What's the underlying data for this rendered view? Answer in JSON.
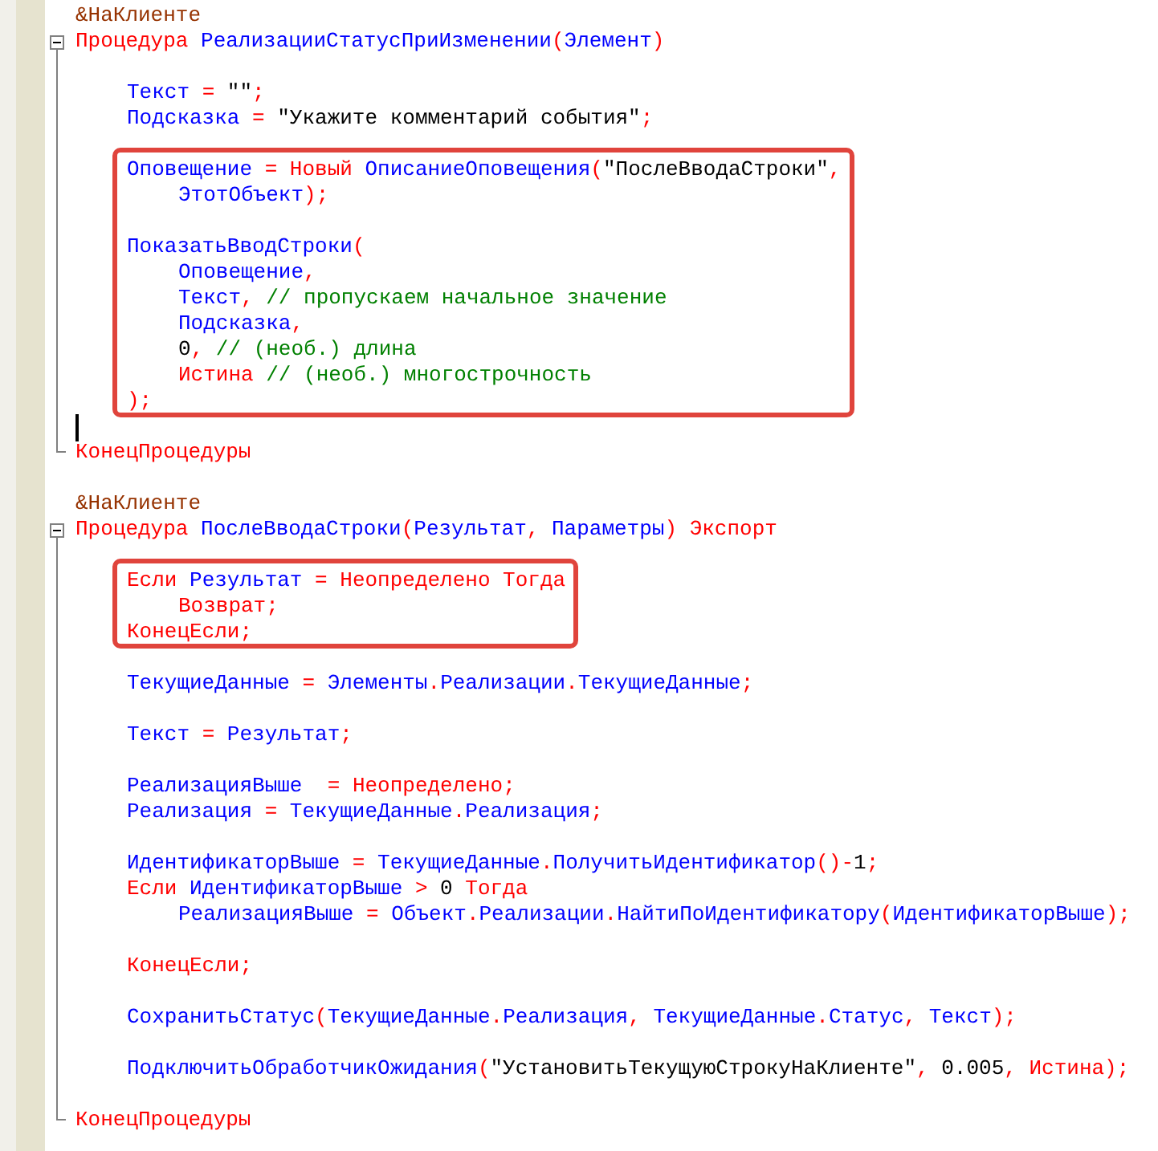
{
  "editor": {
    "blocks": [
      {
        "kind": "directive",
        "text": "&НаКлиенте"
      },
      {
        "kind": "procedure",
        "header": [
          {
            "kind": "keyword",
            "text": "Процедура "
          },
          {
            "kind": "name",
            "text": "РеализацииСтатусПриИзменении"
          },
          {
            "kind": "operator",
            "text": "("
          },
          {
            "kind": "name",
            "text": "Элемент"
          },
          {
            "kind": "operator",
            "text": ")"
          }
        ],
        "body": [
          {
            "kind": "blank"
          },
          {
            "kind": "line",
            "tokens": [
              {
                "kind": "name",
                "text": "Текст"
              },
              {
                "kind": "operator",
                "text": " = "
              },
              {
                "kind": "string",
                "text": "\"\""
              },
              {
                "kind": "operator",
                "text": ";"
              }
            ]
          },
          {
            "kind": "line",
            "tokens": [
              {
                "kind": "name",
                "text": "Подсказка"
              },
              {
                "kind": "operator",
                "text": " = "
              },
              {
                "kind": "string",
                "text": "\"Укажите комментарий события\""
              },
              {
                "kind": "operator",
                "text": ";"
              }
            ]
          },
          {
            "kind": "blank"
          },
          {
            "kind": "highlight",
            "children": [
              {
                "kind": "line",
                "tokens": [
                  {
                    "kind": "name",
                    "text": "Оповещение"
                  },
                  {
                    "kind": "operator",
                    "text": " = "
                  },
                  {
                    "kind": "keyword",
                    "text": "Новый "
                  },
                  {
                    "kind": "name",
                    "text": "ОписаниеОповещения"
                  },
                  {
                    "kind": "operator",
                    "text": "("
                  },
                  {
                    "kind": "string",
                    "text": "\"ПослеВводаСтроки\""
                  },
                  {
                    "kind": "operator",
                    "text": ","
                  }
                ],
                "children": [
                  {
                    "kind": "line",
                    "tokens": [
                      {
                        "kind": "name",
                        "text": "ЭтотОбъект"
                      },
                      {
                        "kind": "operator",
                        "text": ");"
                      }
                    ]
                  }
                ]
              },
              {
                "kind": "blank"
              },
              {
                "kind": "line",
                "tokens": [
                  {
                    "kind": "name",
                    "text": "ПоказатьВводСтроки"
                  },
                  {
                    "kind": "operator",
                    "text": "("
                  }
                ],
                "children": [
                  {
                    "kind": "line",
                    "tokens": [
                      {
                        "kind": "name",
                        "text": "Оповещение"
                      },
                      {
                        "kind": "operator",
                        "text": ","
                      }
                    ]
                  },
                  {
                    "kind": "line",
                    "tokens": [
                      {
                        "kind": "name",
                        "text": "Текст"
                      },
                      {
                        "kind": "operator",
                        "text": ", "
                      },
                      {
                        "kind": "comment",
                        "text": "// пропускаем начальное значение"
                      }
                    ]
                  },
                  {
                    "kind": "line",
                    "tokens": [
                      {
                        "kind": "name",
                        "text": "Подсказка"
                      },
                      {
                        "kind": "operator",
                        "text": ","
                      }
                    ]
                  },
                  {
                    "kind": "line",
                    "tokens": [
                      {
                        "kind": "number",
                        "text": "0"
                      },
                      {
                        "kind": "operator",
                        "text": ", "
                      },
                      {
                        "kind": "comment",
                        "text": "// (необ.) длина"
                      }
                    ]
                  },
                  {
                    "kind": "line",
                    "tokens": [
                      {
                        "kind": "keyword",
                        "text": "Истина "
                      },
                      {
                        "kind": "comment",
                        "text": "// (необ.) многострочность"
                      }
                    ]
                  }
                ]
              },
              {
                "kind": "line",
                "tokens": [
                  {
                    "kind": "operator",
                    "text": ");"
                  }
                ]
              }
            ]
          },
          {
            "kind": "blank",
            "cursor": true
          }
        ],
        "footer": [
          {
            "kind": "keyword",
            "text": "КонецПроцедуры"
          }
        ]
      },
      {
        "kind": "blank"
      },
      {
        "kind": "directive",
        "text": "&НаКлиенте"
      },
      {
        "kind": "procedure",
        "header": [
          {
            "kind": "keyword",
            "text": "Процедура "
          },
          {
            "kind": "name",
            "text": "ПослеВводаСтроки"
          },
          {
            "kind": "operator",
            "text": "("
          },
          {
            "kind": "name",
            "text": "Результат"
          },
          {
            "kind": "operator",
            "text": ", "
          },
          {
            "kind": "name",
            "text": "Параметры"
          },
          {
            "kind": "operator",
            "text": ") "
          },
          {
            "kind": "keyword",
            "text": "Экспорт"
          }
        ],
        "body": [
          {
            "kind": "blank"
          },
          {
            "kind": "highlight",
            "children": [
              {
                "kind": "line",
                "tokens": [
                  {
                    "kind": "keyword",
                    "text": "Если "
                  },
                  {
                    "kind": "name",
                    "text": "Результат"
                  },
                  {
                    "kind": "operator",
                    "text": " = "
                  },
                  {
                    "kind": "keyword",
                    "text": "Неопределено Тогда"
                  }
                ],
                "children": [
                  {
                    "kind": "line",
                    "tokens": [
                      {
                        "kind": "keyword",
                        "text": "Возврат;"
                      }
                    ]
                  }
                ]
              },
              {
                "kind": "line",
                "tokens": [
                  {
                    "kind": "keyword",
                    "text": "КонецЕсли;"
                  }
                ]
              }
            ]
          },
          {
            "kind": "blank"
          },
          {
            "kind": "line",
            "tokens": [
              {
                "kind": "name",
                "text": "ТекущиеДанные"
              },
              {
                "kind": "operator",
                "text": " = "
              },
              {
                "kind": "name",
                "text": "Элементы"
              },
              {
                "kind": "operator",
                "text": "."
              },
              {
                "kind": "name",
                "text": "Реализации"
              },
              {
                "kind": "operator",
                "text": "."
              },
              {
                "kind": "name",
                "text": "ТекущиеДанные"
              },
              {
                "kind": "operator",
                "text": ";"
              }
            ]
          },
          {
            "kind": "blank"
          },
          {
            "kind": "line",
            "tokens": [
              {
                "kind": "name",
                "text": "Текст"
              },
              {
                "kind": "operator",
                "text": " = "
              },
              {
                "kind": "name",
                "text": "Результат"
              },
              {
                "kind": "operator",
                "text": ";"
              }
            ]
          },
          {
            "kind": "blank"
          },
          {
            "kind": "line",
            "tokens": [
              {
                "kind": "name",
                "text": "РеализацияВыше"
              },
              {
                "kind": "operator",
                "text": "  = "
              },
              {
                "kind": "keyword",
                "text": "Неопределено"
              },
              {
                "kind": "operator",
                "text": ";"
              }
            ]
          },
          {
            "kind": "line",
            "tokens": [
              {
                "kind": "name",
                "text": "Реализация"
              },
              {
                "kind": "operator",
                "text": " = "
              },
              {
                "kind": "name",
                "text": "ТекущиеДанные"
              },
              {
                "kind": "operator",
                "text": "."
              },
              {
                "kind": "name",
                "text": "Реализация"
              },
              {
                "kind": "operator",
                "text": ";"
              }
            ]
          },
          {
            "kind": "blank"
          },
          {
            "kind": "line",
            "tokens": [
              {
                "kind": "name",
                "text": "ИдентификаторВыше"
              },
              {
                "kind": "operator",
                "text": " = "
              },
              {
                "kind": "name",
                "text": "ТекущиеДанные"
              },
              {
                "kind": "operator",
                "text": "."
              },
              {
                "kind": "name",
                "text": "ПолучитьИдентификатор"
              },
              {
                "kind": "operator",
                "text": "()-"
              },
              {
                "kind": "number",
                "text": "1"
              },
              {
                "kind": "operator",
                "text": ";"
              }
            ]
          },
          {
            "kind": "line",
            "tokens": [
              {
                "kind": "keyword",
                "text": "Если "
              },
              {
                "kind": "name",
                "text": "ИдентификаторВыше"
              },
              {
                "kind": "operator",
                "text": " > "
              },
              {
                "kind": "number",
                "text": "0 "
              },
              {
                "kind": "keyword",
                "text": "Тогда"
              }
            ],
            "children": [
              {
                "kind": "line",
                "tokens": [
                  {
                    "kind": "name",
                    "text": "РеализацияВыше"
                  },
                  {
                    "kind": "operator",
                    "text": " = "
                  },
                  {
                    "kind": "name",
                    "text": "Объект"
                  },
                  {
                    "kind": "operator",
                    "text": "."
                  },
                  {
                    "kind": "name",
                    "text": "Реализации"
                  },
                  {
                    "kind": "operator",
                    "text": "."
                  },
                  {
                    "kind": "name",
                    "text": "НайтиПоИдентификатору"
                  },
                  {
                    "kind": "operator",
                    "text": "("
                  },
                  {
                    "kind": "name",
                    "text": "ИдентификаторВыше"
                  },
                  {
                    "kind": "operator",
                    "text": ");"
                  }
                ]
              }
            ]
          },
          {
            "kind": "blank"
          },
          {
            "kind": "line",
            "tokens": [
              {
                "kind": "keyword",
                "text": "КонецЕсли;"
              }
            ]
          },
          {
            "kind": "blank"
          },
          {
            "kind": "line",
            "tokens": [
              {
                "kind": "name",
                "text": "СохранитьСтатус"
              },
              {
                "kind": "operator",
                "text": "("
              },
              {
                "kind": "name",
                "text": "ТекущиеДанные"
              },
              {
                "kind": "operator",
                "text": "."
              },
              {
                "kind": "name",
                "text": "Реализация"
              },
              {
                "kind": "operator",
                "text": ", "
              },
              {
                "kind": "name",
                "text": "ТекущиеДанные"
              },
              {
                "kind": "operator",
                "text": "."
              },
              {
                "kind": "name",
                "text": "Статус"
              },
              {
                "kind": "operator",
                "text": ", "
              },
              {
                "kind": "name",
                "text": "Текст"
              },
              {
                "kind": "operator",
                "text": ");"
              }
            ]
          },
          {
            "kind": "blank"
          },
          {
            "kind": "line",
            "tokens": [
              {
                "kind": "name",
                "text": "ПодключитьОбработчикОжидания"
              },
              {
                "kind": "operator",
                "text": "("
              },
              {
                "kind": "string",
                "text": "\"УстановитьТекущуюСтрокуНаКлиенте\""
              },
              {
                "kind": "operator",
                "text": ", "
              },
              {
                "kind": "number",
                "text": "0.005"
              },
              {
                "kind": "operator",
                "text": ", "
              },
              {
                "kind": "keyword",
                "text": "Истина"
              },
              {
                "kind": "operator",
                "text": ");"
              }
            ]
          },
          {
            "kind": "blank"
          }
        ],
        "footer": [
          {
            "kind": "keyword",
            "text": "КонецПроцедуры"
          }
        ]
      }
    ]
  }
}
